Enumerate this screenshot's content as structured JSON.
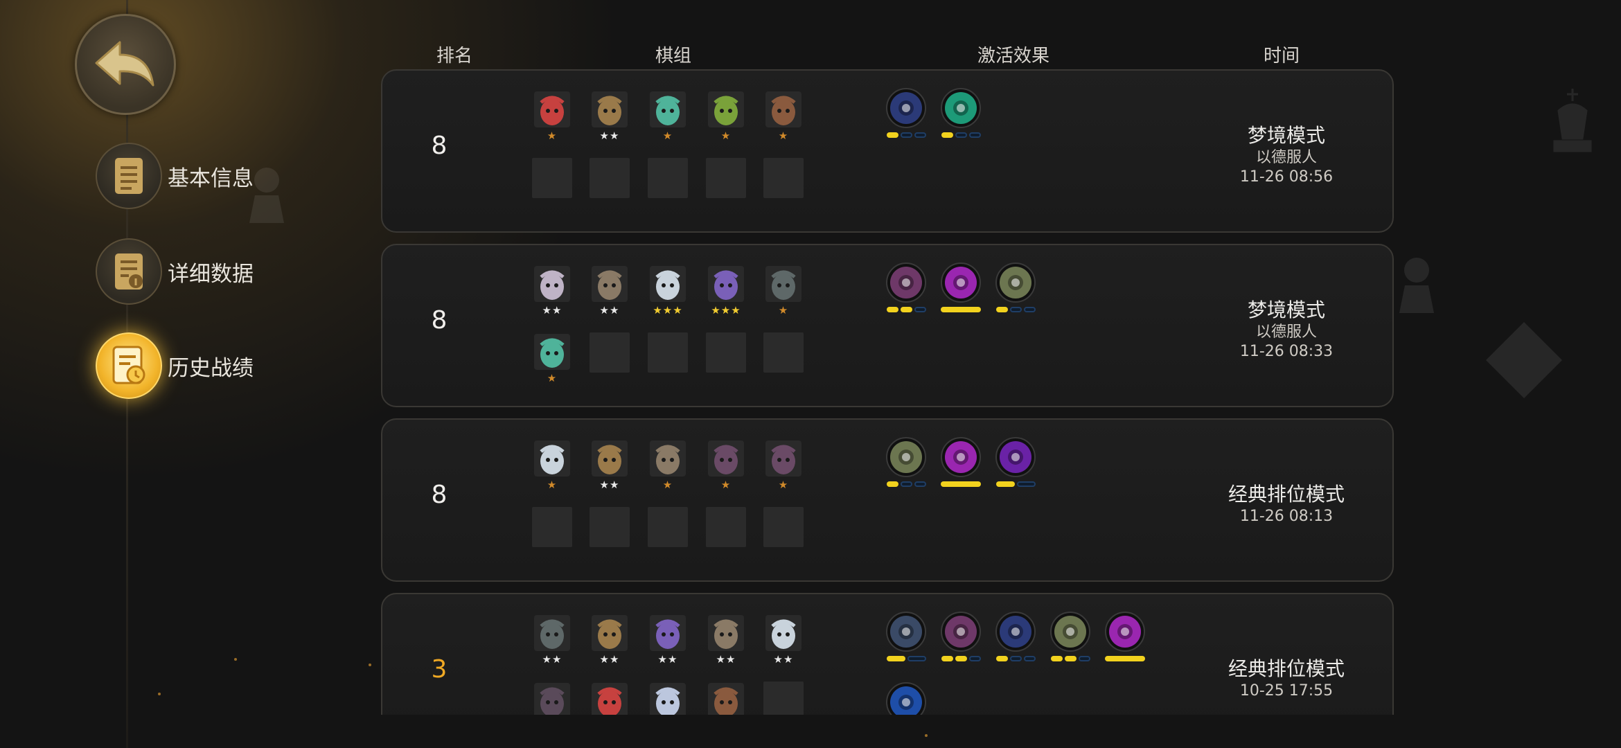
{
  "sidebar": {
    "items": [
      {
        "label": "基本信息",
        "icon": "document-icon",
        "active": false
      },
      {
        "label": "详细数据",
        "icon": "document-info-icon",
        "active": false
      },
      {
        "label": "历史战绩",
        "icon": "history-icon",
        "active": true
      }
    ]
  },
  "table": {
    "headers": {
      "rank": "排名",
      "lineup": "棋组",
      "synergies": "激活效果",
      "time": "时间"
    }
  },
  "records": [
    {
      "rank": "8",
      "heroes": [
        {
          "icon": "red-beast-portrait-icon",
          "stars": "★",
          "color": "#c7413f"
        },
        {
          "icon": "tree-ent-portrait-icon",
          "stars": "★★",
          "color": "#9a7a4a"
        },
        {
          "icon": "green-elf-portrait-icon",
          "stars": "★",
          "color": "#4fb39a"
        },
        {
          "icon": "green-goblin-portrait-icon",
          "stars": "★",
          "color": "#7aa23a"
        },
        {
          "icon": "rogue-portrait-icon",
          "stars": "★",
          "color": "#8a5a3e"
        }
      ],
      "empty_slots": 5,
      "synergies": [
        {
          "icon": "tech-synergy-icon",
          "color": "#2b3a78",
          "active": 1,
          "total": 3
        },
        {
          "icon": "beast-paw-synergy-icon",
          "color": "#1d9a78",
          "active": 1,
          "total": 3
        }
      ],
      "mode": "梦境模式",
      "sub": "以德服人",
      "time": "11-26 08:56"
    },
    {
      "rank": "8",
      "heroes": [
        {
          "icon": "white-hair-mage-portrait-icon",
          "stars": "★★",
          "color": "#bfb3c6"
        },
        {
          "icon": "ogre-portrait-icon",
          "stars": "★★",
          "color": "#8a7a66"
        },
        {
          "icon": "cloud-spirit-portrait-icon",
          "stars": "★★★",
          "color": "#c9d3dc"
        },
        {
          "icon": "purple-demon-portrait-icon",
          "stars": "★★★",
          "color": "#7a60b8"
        },
        {
          "icon": "masked-knight-portrait-icon",
          "stars": "★",
          "color": "#5e6868"
        },
        {
          "icon": "green-elf-portrait-icon",
          "stars": "★",
          "color": "#4fb39a"
        }
      ],
      "empty_slots": 4,
      "synergies": [
        {
          "icon": "knight-chess-synergy-icon",
          "color": "#6e3868",
          "active": 2,
          "total": 3
        },
        {
          "icon": "demon-synergy-icon",
          "color": "#9a26b0",
          "active": 1,
          "total": 1
        },
        {
          "icon": "spirit-synergy-icon",
          "color": "#6c7650",
          "active": 1,
          "total": 3
        }
      ],
      "mode": "梦境模式",
      "sub": "以德服人",
      "time": "11-26 08:33"
    },
    {
      "rank": "8",
      "heroes": [
        {
          "icon": "cloud-spirit-portrait-icon",
          "stars": "★",
          "color": "#c9d3dc"
        },
        {
          "icon": "tree-ent-portrait-icon",
          "stars": "★★",
          "color": "#9a7a4a"
        },
        {
          "icon": "ogre-portrait-icon",
          "stars": "★",
          "color": "#8a7a66"
        },
        {
          "icon": "hooded-assassin-portrait-icon",
          "stars": "★",
          "color": "#6a4a66"
        },
        {
          "icon": "hooded-assassin-portrait-icon",
          "stars": "★",
          "color": "#6a4a66"
        }
      ],
      "empty_slots": 5,
      "synergies": [
        {
          "icon": "spirit-synergy-icon",
          "color": "#6c7650",
          "active": 1,
          "total": 3
        },
        {
          "icon": "demon-synergy-icon",
          "color": "#9a26b0",
          "active": 1,
          "total": 1
        },
        {
          "icon": "shadow-synergy-icon",
          "color": "#6a22a6",
          "active": 1,
          "total": 2
        }
      ],
      "mode": "经典排位模式",
      "sub": "",
      "time": "11-26 08:13"
    },
    {
      "rank": "3",
      "heroes": [
        {
          "icon": "masked-knight-portrait-icon",
          "stars": "★★",
          "color": "#5e6868"
        },
        {
          "icon": "tree-ent-portrait-icon",
          "stars": "★★",
          "color": "#9a7a4a"
        },
        {
          "icon": "purple-demon-portrait-icon",
          "stars": "★★",
          "color": "#7a60b8"
        },
        {
          "icon": "ogre-portrait-icon",
          "stars": "★★",
          "color": "#8a7a66"
        },
        {
          "icon": "cloud-spirit-portrait-icon",
          "stars": "★★",
          "color": "#c9d3dc"
        },
        {
          "icon": "dark-hair-portrait-icon",
          "stars": "",
          "color": "#5a4a5a"
        },
        {
          "icon": "red-beast-portrait-icon",
          "stars": "",
          "color": "#c7413f"
        },
        {
          "icon": "white-ghost-portrait-icon",
          "stars": "",
          "color": "#bcc7de"
        },
        {
          "icon": "rogue-portrait-icon",
          "stars": "",
          "color": "#8a5a3e"
        }
      ],
      "empty_slots": 1,
      "synergies": [
        {
          "icon": "warrior-synergy-icon",
          "color": "#3a4a66",
          "active": 1,
          "total": 2
        },
        {
          "icon": "knight-chess-synergy-icon",
          "color": "#6e3868",
          "active": 2,
          "total": 3
        },
        {
          "icon": "tech-synergy-icon",
          "color": "#2b3a78",
          "active": 1,
          "total": 3
        },
        {
          "icon": "spirit-synergy-icon",
          "color": "#6c7650",
          "active": 2,
          "total": 3
        },
        {
          "icon": "demon-synergy-icon",
          "color": "#9a26b0",
          "active": 1,
          "total": 1
        },
        {
          "icon": "mech-synergy-icon",
          "color": "#1e4ea8",
          "active": 0,
          "total": 0
        }
      ],
      "mode": "经典排位模式",
      "sub": "",
      "time": "10-25 17:55"
    }
  ],
  "colors": {
    "gold_rank": "#f0a924",
    "bar_on": "#f2d21e",
    "bar_off": "#1f3e66"
  }
}
